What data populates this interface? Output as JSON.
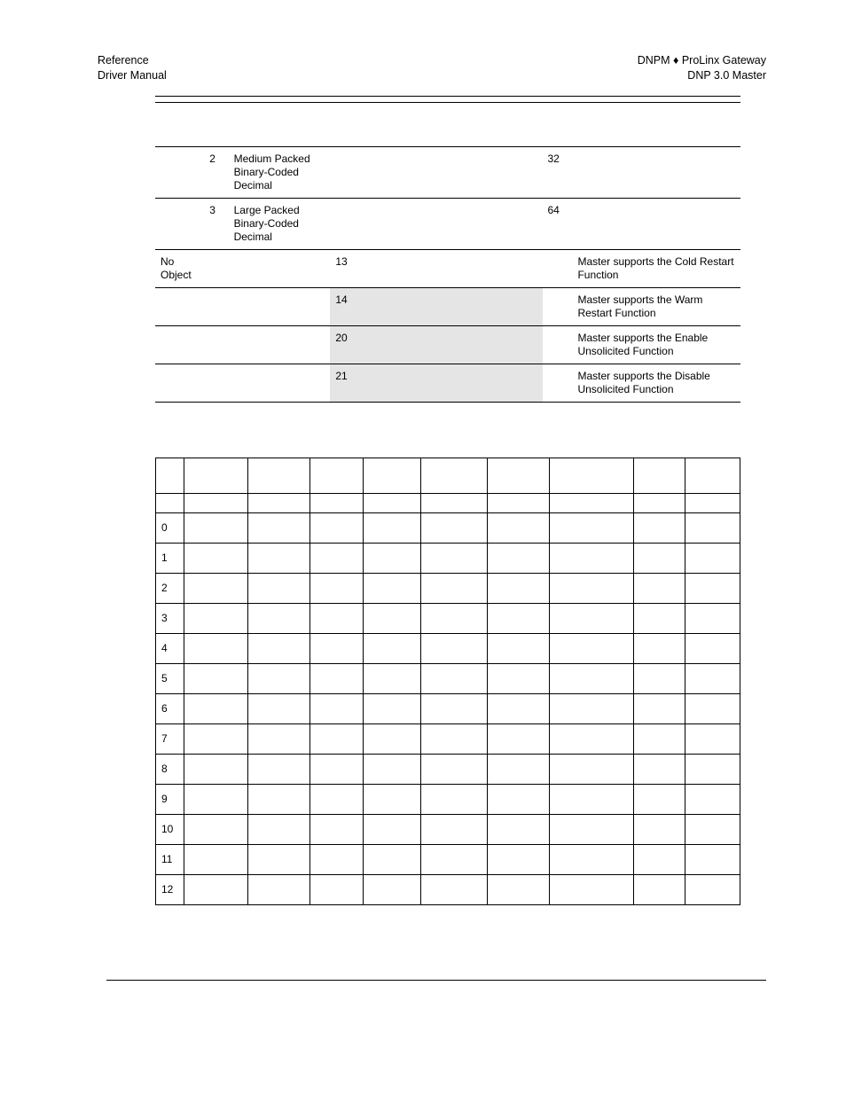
{
  "header": {
    "left_line1": "Reference",
    "left_line2": "Driver Manual",
    "right_line1": "DNPM ♦ ProLinx Gateway",
    "right_line2": "DNP 3.0 Master"
  },
  "table1": {
    "rows": [
      {
        "object": "",
        "variation": "2",
        "description": "Medium Packed Binary-Coded Decimal",
        "func": "",
        "mid": "",
        "size": "32",
        "note": "",
        "shaded": false
      },
      {
        "object": "",
        "variation": "3",
        "description": "Large Packed Binary-Coded Decimal",
        "func": "",
        "mid": "",
        "size": "64",
        "note": "",
        "shaded": false
      },
      {
        "object": "No Object",
        "variation": "",
        "description": "",
        "func": "13",
        "mid": "",
        "size": "",
        "note": "Master supports the Cold Restart Function",
        "shaded": false
      },
      {
        "object": "",
        "variation": "",
        "description": "",
        "func": "14",
        "mid": "",
        "size": "",
        "note": "Master supports the Warm Restart Function",
        "shaded": true
      },
      {
        "object": "",
        "variation": "",
        "description": "",
        "func": "20",
        "mid": "",
        "size": "",
        "note": "Master supports the Enable Unsolicited Function",
        "shaded": true
      },
      {
        "object": "",
        "variation": "",
        "description": "",
        "func": "21",
        "mid": "",
        "size": "",
        "note": "Master supports the Disable Unsolicited Function",
        "shaded": true
      }
    ]
  },
  "table2": {
    "indices": [
      "0",
      "1",
      "2",
      "3",
      "4",
      "5",
      "6",
      "7",
      "8",
      "9",
      "10",
      "11",
      "12"
    ]
  }
}
